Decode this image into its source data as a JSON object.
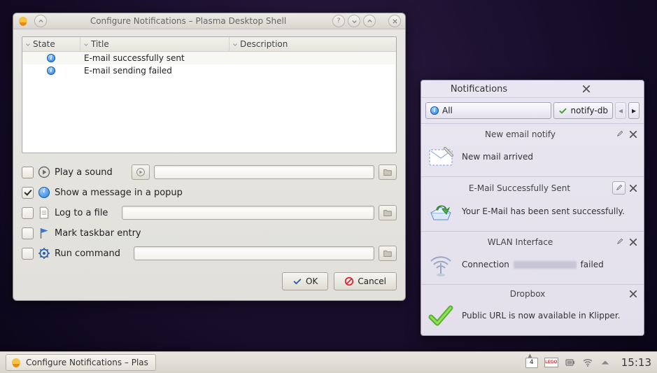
{
  "cfg": {
    "title": "Configure Notifications – Plasma Desktop Shell",
    "cols": {
      "state": "State",
      "title": "Title",
      "desc": "Description"
    },
    "rows": [
      {
        "title": "E-mail successfully sent"
      },
      {
        "title": "E-mail sending failed"
      }
    ],
    "opts": {
      "sound": "Play a sound",
      "popup": "Show a message in a popup",
      "log": "Log to a file",
      "taskbar": "Mark taskbar entry",
      "cmd": "Run command"
    },
    "ok": "OK",
    "cancel": "Cancel"
  },
  "notif": {
    "header": "Notifications",
    "filterAll": "All",
    "filterSource": "notify-db",
    "items": [
      {
        "title": "New email notify",
        "text": "New mail arrived",
        "wrench": true
      },
      {
        "title": "E-Mail Successfully Sent",
        "text": "Your E-Mail has been sent successfully.",
        "wrench": true,
        "wrenchBoxed": true
      },
      {
        "title": "WLAN Interface",
        "text_pre": "Connection ",
        "text_post": " failed",
        "wrench": true,
        "blurred": true
      },
      {
        "title": "Dropbox",
        "text": "Public URL is now available in Klipper.",
        "wrench": false
      }
    ]
  },
  "taskbar": {
    "task": "Configure Notifications – Plas",
    "kbd": "4",
    "clock": "15:13"
  }
}
